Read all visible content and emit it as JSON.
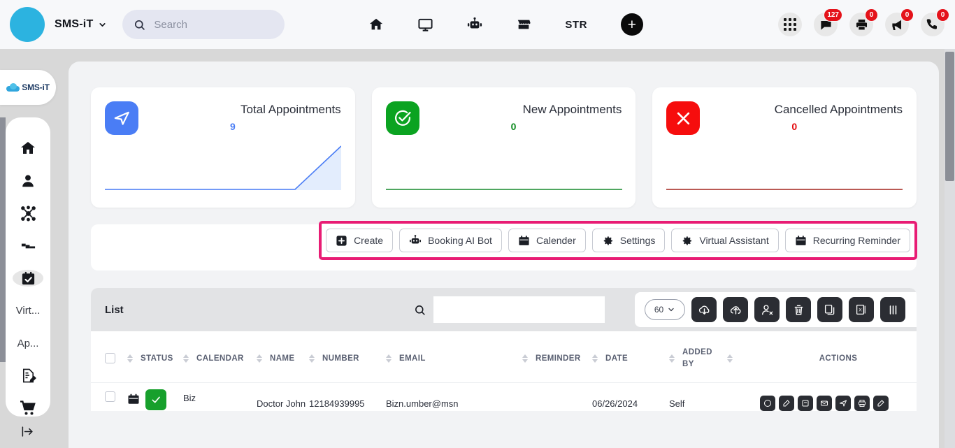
{
  "topbar": {
    "brand_name": "SMS-iT",
    "search_placeholder": "Search",
    "search_value": "",
    "nav_items": [
      {
        "name": "home-icon",
        "label": ""
      },
      {
        "name": "monitor-icon",
        "label": ""
      },
      {
        "name": "robot-icon",
        "label": ""
      },
      {
        "name": "store-icon",
        "label": ""
      },
      {
        "name": "str-link",
        "label": "STR"
      }
    ],
    "plus_label": "+",
    "right_icons": [
      {
        "name": "apps-grid-icon",
        "badge": ""
      },
      {
        "name": "chat-icon",
        "badge": "127"
      },
      {
        "name": "printer-icon",
        "badge": "0"
      },
      {
        "name": "megaphone-icon",
        "badge": "0"
      },
      {
        "name": "phone-icon",
        "badge": "0"
      }
    ]
  },
  "sidebar": {
    "logo_text": "SMS-iT",
    "items": [
      {
        "name": "sidebar-item-home",
        "icon": "home-icon",
        "label": ""
      },
      {
        "name": "sidebar-item-contacts",
        "icon": "person-icon",
        "label": ""
      },
      {
        "name": "sidebar-item-network",
        "icon": "network-icon",
        "label": ""
      },
      {
        "name": "sidebar-item-pipeline",
        "icon": "funnel-icon",
        "label": ""
      },
      {
        "name": "sidebar-item-appointments",
        "icon": "calendar-check-icon",
        "label": ""
      },
      {
        "name": "sidebar-item-virtual",
        "icon": "",
        "label": "Virt..."
      },
      {
        "name": "sidebar-item-apps",
        "icon": "",
        "label": "Ap..."
      },
      {
        "name": "sidebar-item-forms",
        "icon": "document-edit-icon",
        "label": ""
      },
      {
        "name": "sidebar-item-store",
        "icon": "cart-icon",
        "label": ""
      }
    ],
    "collapse_label": ""
  },
  "cards": [
    {
      "title": "Total Appointments",
      "value": "9",
      "color": "#4a7df5",
      "icon": "send-icon",
      "value_color": "#4a7df5"
    },
    {
      "title": "New Appointments",
      "value": "0",
      "color": "#0ba321",
      "icon": "check-circle-icon",
      "value_color": "#0c8a1e"
    },
    {
      "title": "Cancelled Appointments",
      "value": "0",
      "color": "#f60d0d",
      "icon": "x-icon",
      "value_color": "#e3070b"
    }
  ],
  "action_buttons": [
    {
      "label": "Create",
      "icon": "plus-square-icon"
    },
    {
      "label": "Booking AI Bot",
      "icon": "robot-icon"
    },
    {
      "label": "Calender",
      "icon": "calendar-icon"
    },
    {
      "label": "Settings",
      "icon": "gear-icon"
    },
    {
      "label": "Virtual Assistant",
      "icon": "gear-icon"
    },
    {
      "label": "Recurring Reminder",
      "icon": "calendar-icon"
    }
  ],
  "highlight_color": "#e81c74",
  "list": {
    "title": "List",
    "search_value": "",
    "search_placeholder": "",
    "page_size": "60",
    "tool_buttons": [
      {
        "name": "import-cloud-button",
        "icon": "cloud-download-icon"
      },
      {
        "name": "export-cloud-button",
        "icon": "cloud-upload-icon"
      },
      {
        "name": "unassign-user-button",
        "icon": "user-remove-icon"
      },
      {
        "name": "delete-button",
        "icon": "trash-icon"
      },
      {
        "name": "duplicate-button",
        "icon": "copy-icon"
      },
      {
        "name": "excel-export-button",
        "icon": "excel-icon"
      },
      {
        "name": "columns-button",
        "icon": "columns-icon"
      }
    ]
  },
  "table": {
    "columns": [
      "STATUS",
      "CALENDAR",
      "NAME",
      "NUMBER",
      "EMAIL",
      "REMINDER",
      "DATE",
      "ADDED BY",
      "ACTIONS"
    ],
    "rows": [
      {
        "status": "confirmed",
        "calendar": "Biz",
        "name": "Doctor John",
        "number": "12184939995",
        "email": "Bizn.umber@msn",
        "reminder": "",
        "date": "06/26/2024",
        "added_by": "Self",
        "actions": [
          "view-icon",
          "edit-icon",
          "notes-icon",
          "mail-icon",
          "send-icon",
          "print-icon",
          "check-icon"
        ]
      }
    ]
  }
}
